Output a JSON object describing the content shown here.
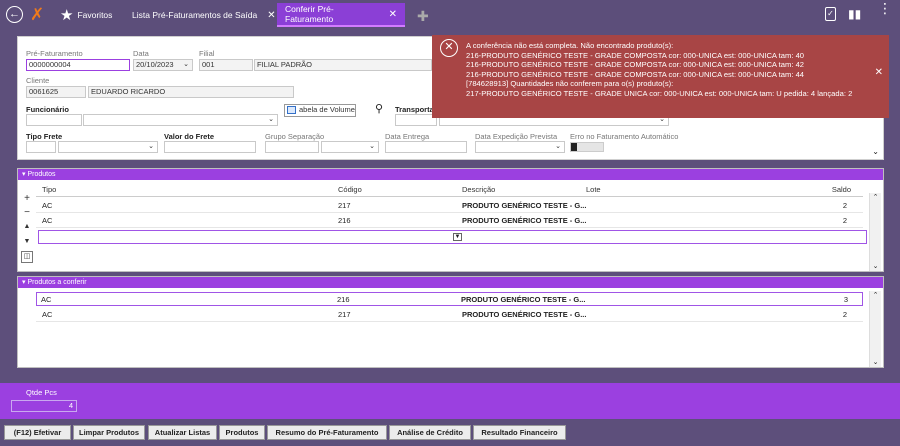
{
  "tabs": [
    {
      "label": "Favoritos"
    },
    {
      "label": "Lista Pré-Faturamentos de Saída"
    },
    {
      "label": "Conferir Pré-Faturamento"
    }
  ],
  "form": {
    "pre_faturamento_label": "Pré-Faturamento",
    "pre_faturamento_value": "0000000004",
    "data_label": "Data",
    "data_value": "20/10/2023",
    "filial_label": "Filial",
    "filial_code": "001",
    "filial_name": "FILIAL PADRÃO",
    "cliente_label": "Cliente",
    "cliente_code": "0061625",
    "cliente_name": "EDUARDO RICARDO",
    "funcionario_label": "Funcionário",
    "tabela_volume_label": "abela de Volume",
    "transportadora_label": "Transportadora",
    "tipo_frete_label": "Tipo Frete",
    "valor_frete_label": "Valor do Frete",
    "grupo_separacao_label": "Grupo Separação",
    "data_entrega_label": "Data Entrega",
    "data_expedicao_label": "Data Expedição Prevista",
    "erro_faturamento_label": "Erro no Faturamento Automático"
  },
  "produtos": {
    "title": "Produtos",
    "columns": [
      "Tipo",
      "Código",
      "Descrição",
      "Lote",
      "Saldo"
    ],
    "rows": [
      {
        "tipo": "AC",
        "codigo": "217",
        "descricao": "PRODUTO GENÉRICO TESTE - G...",
        "lote": "",
        "saldo": "2"
      },
      {
        "tipo": "AC",
        "codigo": "216",
        "descricao": "PRODUTO GENÉRICO TESTE - G...",
        "lote": "",
        "saldo": "2"
      }
    ]
  },
  "conferir": {
    "title": "Produtos a conferir",
    "rows": [
      {
        "tipo": "AC",
        "codigo": "216",
        "descricao": "PRODUTO GENÉRICO TESTE - G...",
        "saldo": "3"
      },
      {
        "tipo": "AC",
        "codigo": "217",
        "descricao": "PRODUTO GENÉRICO TESTE - G...",
        "saldo": "2"
      }
    ]
  },
  "error": {
    "lines": [
      "A conferência não está completa. Não encontrado produto(s):",
      "216-PRODUTO GENÉRICO TESTE - GRADE COMPOSTA cor: 000-UNICA est: 000-UNICA tam: 40",
      "216-PRODUTO GENÉRICO TESTE - GRADE COMPOSTA cor: 000-UNICA est: 000-UNICA tam: 42",
      "216-PRODUTO GENÉRICO TESTE - GRADE COMPOSTA cor: 000-UNICA est: 000-UNICA tam: 44",
      "[784628913] Quantidades não conferem para o(s) produto(s):",
      "217-PRODUTO GENÉRICO TESTE - GRADE UNICA cor: 000-UNICA est: 000-UNICA tam: U pedida: 4 lançada: 2"
    ]
  },
  "qtde": {
    "label": "Qtde Pcs",
    "value": "4"
  },
  "buttons": [
    "(F12) Efetivar",
    "Limpar Produtos",
    "Atualizar Listas",
    "Produtos",
    "Resumo do Pré-Faturamento",
    "Análise de Crédito",
    "Resultado Financeiro"
  ],
  "icons": {
    "back": "back-arrow-icon",
    "logo": "brand-logo-icon",
    "favorites": "star-icon",
    "add_tab": "plus-icon",
    "clipboard": "clipboard-check-icon",
    "chat": "chat-icon",
    "menu": "kebab-menu-icon",
    "error": "error-circle-icon",
    "search": "search-icon"
  }
}
